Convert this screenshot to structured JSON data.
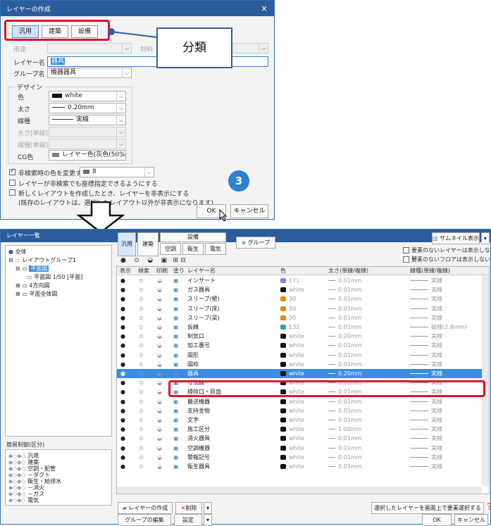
{
  "dialog": {
    "title": "レイヤーの作成",
    "close_glyph": "×",
    "category_tabs": [
      "汎用",
      "建築",
      "設備"
    ],
    "rows": {
      "usage": {
        "label": "用途",
        "value": ""
      },
      "material_label": "材料",
      "layer_name": {
        "label": "レイヤー名",
        "value": "器具"
      },
      "group_name": {
        "label": "グループ名",
        "value": "機器器具"
      }
    },
    "design": {
      "label": "デザイン",
      "color": {
        "label": "色",
        "value": "white",
        "swatch": "#111111"
      },
      "thickness": {
        "label": "太さ",
        "value": "0.20mm"
      },
      "linetype": {
        "label": "線種",
        "value": "実線"
      },
      "thickness_single": {
        "label": "太さ[単線]"
      },
      "linetype_single": {
        "label": "線種[単線]"
      },
      "cg_color": {
        "label": "CG色",
        "value": "レイヤー色(灰色(50%))",
        "swatch": "#808080"
      }
    },
    "options": {
      "nonsearch_color": {
        "label": "非検索時の色を変更する",
        "checked": true,
        "value": "8",
        "swatch": "#6e6e6e"
      },
      "snap_nonsearch": {
        "label": "レイヤーが非検索でも座標指定できるようにする",
        "checked": false
      },
      "hide_new_layout": {
        "label": "新しくレイアウトを作成したとき、レイヤーを非表示にする",
        "note": "(既存のレイアウトは、選択したレイアウト以外が非表示になります)",
        "checked": false
      }
    },
    "ok_label": "OK",
    "cancel_label": "キャンセル"
  },
  "callout": {
    "text": "分類"
  },
  "badge": {
    "text": "3"
  },
  "window": {
    "title": "レイヤー一覧",
    "minimize_glyph": "_",
    "maximize_glyph": "□",
    "close_glyph": "×",
    "tree": [
      {
        "label": "全体",
        "indent": 0
      },
      {
        "label": "レイアウトグループ1",
        "indent": 1
      },
      {
        "label": "平面図",
        "indent": 2
      },
      {
        "label": "平面図 1/50 [平面]",
        "indent": 3
      },
      {
        "label": "4方向図",
        "indent": 2
      },
      {
        "label": "平面全体図",
        "indent": 2
      }
    ],
    "simple_panel": {
      "title": "簡易制御(区分)",
      "items": [
        "汎用",
        "建築",
        "空調・配管",
        "－ダクト",
        "衛生・給排水",
        "－消火",
        "－ガス",
        "電気"
      ]
    },
    "toolbar": {
      "general": "汎用",
      "building": "建築",
      "equipment": "設備",
      "hvac": "空調",
      "sanitary": "衛生",
      "electric": "電気",
      "group": "グループ",
      "thumbnail": "サムネイル表示",
      "hide_empty_layers": "要素のないレイヤーは表示しない",
      "hide_empty_floors": "要素のないフロアは表示しない"
    },
    "table": {
      "headers": [
        "表示",
        "検索",
        "印刷",
        "塗り",
        "レイヤー名",
        "色",
        "太さ(単線/複線)",
        "線種(単線/複線)"
      ],
      "rows": [
        {
          "name": "インサート",
          "color": "171",
          "swatch": "#8b7cf6",
          "thickness": "0.01mm",
          "linetype": "実線"
        },
        {
          "name": "ガス器具",
          "color": "white",
          "swatch": "#111111",
          "thickness": "0.01mm",
          "linetype": "実線"
        },
        {
          "name": "スリーブ(壁)",
          "color": "30",
          "swatch": "#e8830f",
          "thickness": "0.01mm",
          "linetype": "実線"
        },
        {
          "name": "スリーブ(床)",
          "color": "30",
          "swatch": "#e8830f",
          "thickness": "0.01mm",
          "linetype": "実線"
        },
        {
          "name": "スリーブ(梁)",
          "color": "30",
          "swatch": "#e8830f",
          "thickness": "0.01mm",
          "linetype": "実線"
        },
        {
          "name": "仮線",
          "color": "132",
          "swatch": "#1ea99c",
          "thickness": "0.01mm",
          "linetype": "破線(2.8mm)"
        },
        {
          "name": "制気口",
          "color": "white",
          "swatch": "#111111",
          "thickness": "0.20mm",
          "linetype": "実線"
        },
        {
          "name": "加工番号",
          "color": "white",
          "swatch": "#111111",
          "thickness": "0.01mm",
          "linetype": "実線"
        },
        {
          "name": "図形",
          "color": "white",
          "swatch": "#111111",
          "thickness": "0.01mm",
          "linetype": "実線"
        },
        {
          "name": "図枠",
          "color": "white",
          "swatch": "#111111",
          "thickness": "0.01mm",
          "linetype": "実線"
        },
        {
          "name": "器具",
          "color": "white",
          "swatch": "#111111",
          "thickness": "0.20mm",
          "linetype": "実線",
          "selected": true
        },
        {
          "name": "寸法線",
          "color": "white",
          "swatch": "#111111",
          "thickness": "0.01mm",
          "linetype": "実線"
        },
        {
          "name": "掃除口・目皿",
          "color": "white",
          "swatch": "#111111",
          "thickness": "0.01mm",
          "linetype": "実線"
        },
        {
          "name": "搬送機器",
          "color": "white",
          "swatch": "#111111",
          "thickness": "0.01mm",
          "linetype": "実線"
        },
        {
          "name": "支持金物",
          "color": "white",
          "swatch": "#111111",
          "thickness": "0.01mm",
          "linetype": "実線"
        },
        {
          "name": "文字",
          "color": "white",
          "swatch": "#111111",
          "thickness": "0.01mm",
          "linetype": "実線"
        },
        {
          "name": "施工区分",
          "color": "white",
          "swatch": "#111111",
          "thickness": "1.00mm",
          "linetype": "実線"
        },
        {
          "name": "消火器具",
          "color": "white",
          "swatch": "#111111",
          "thickness": "0.01mm",
          "linetype": "実線"
        },
        {
          "name": "空調機器",
          "color": "white",
          "swatch": "#111111",
          "thickness": "0.01mm",
          "linetype": "実線"
        },
        {
          "name": "警報記号",
          "color": "white",
          "swatch": "#111111",
          "thickness": "0.01mm",
          "linetype": "実線"
        },
        {
          "name": "衛生器具",
          "color": "white",
          "swatch": "#111111",
          "thickness": "0.01mm",
          "linetype": "実線"
        }
      ]
    },
    "bottom": {
      "create_layer": "レイヤーの作成",
      "delete": "削除",
      "edit_group": "グループの編集",
      "settings": "設定",
      "select_on_screen": "選択したレイヤーを画面上で要素選択する",
      "ok": "OK",
      "cancel": "キャンセル"
    }
  },
  "colors": {
    "accent": "#2b5c9b",
    "highlight": "#e0142b",
    "selection": "#3b8de0",
    "badge": "#2c81d0"
  }
}
